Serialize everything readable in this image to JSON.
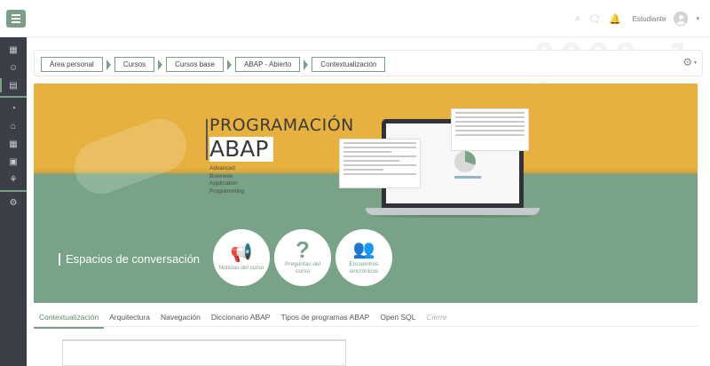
{
  "topbar": {
    "menu_icon": "hamburger-icon",
    "search_icon": "search-icon",
    "messages_icon": "chat-icon",
    "notifications_icon": "bell-icon",
    "user_name": "Estudiante",
    "user_menu_caret": "▾"
  },
  "sidebar": {
    "items": [
      {
        "icon": "grid-icon"
      },
      {
        "icon": "user-icon"
      },
      {
        "icon": "table-icon"
      },
      {
        "icon": "dashboard-icon"
      },
      {
        "icon": "home-icon"
      },
      {
        "icon": "calendar-icon"
      },
      {
        "icon": "files-icon"
      },
      {
        "icon": "graduation-cap-icon"
      },
      {
        "icon": "settings-icon"
      }
    ],
    "accent_color": "#7a9f86"
  },
  "breadcrumb": {
    "items": [
      "Área personal",
      "Cursos",
      "Cursos base",
      "ABAP - Abierto",
      "Contextualización"
    ]
  },
  "background_digits": "0000 1 1",
  "banner": {
    "title": "PROGRAMACIÓN",
    "subtitle": "ABAP",
    "acronym": [
      "Advanced",
      "Business",
      "Application",
      "Programming"
    ],
    "conversation_label": "Espacios de conversación",
    "circles": [
      {
        "icon": "megaphone-icon",
        "glyph": "📢",
        "label": "Noticias del curso"
      },
      {
        "icon": "question-icon",
        "glyph": "?",
        "label": "Preguntas del curso"
      },
      {
        "icon": "meeting-icon",
        "glyph": "👥",
        "label": "Encuentros sincrónicos"
      }
    ],
    "colors": {
      "top": "#e6b13f",
      "bottom": "#78a386"
    }
  },
  "tabs": [
    {
      "label": "Contextualización",
      "active": true
    },
    {
      "label": "Arquitectura"
    },
    {
      "label": "Navegación"
    },
    {
      "label": "Diccionario ABAP"
    },
    {
      "label": "Tipos de programas ABAP"
    },
    {
      "label": "Open SQL"
    },
    {
      "label": "Cierre",
      "muted": true
    }
  ]
}
